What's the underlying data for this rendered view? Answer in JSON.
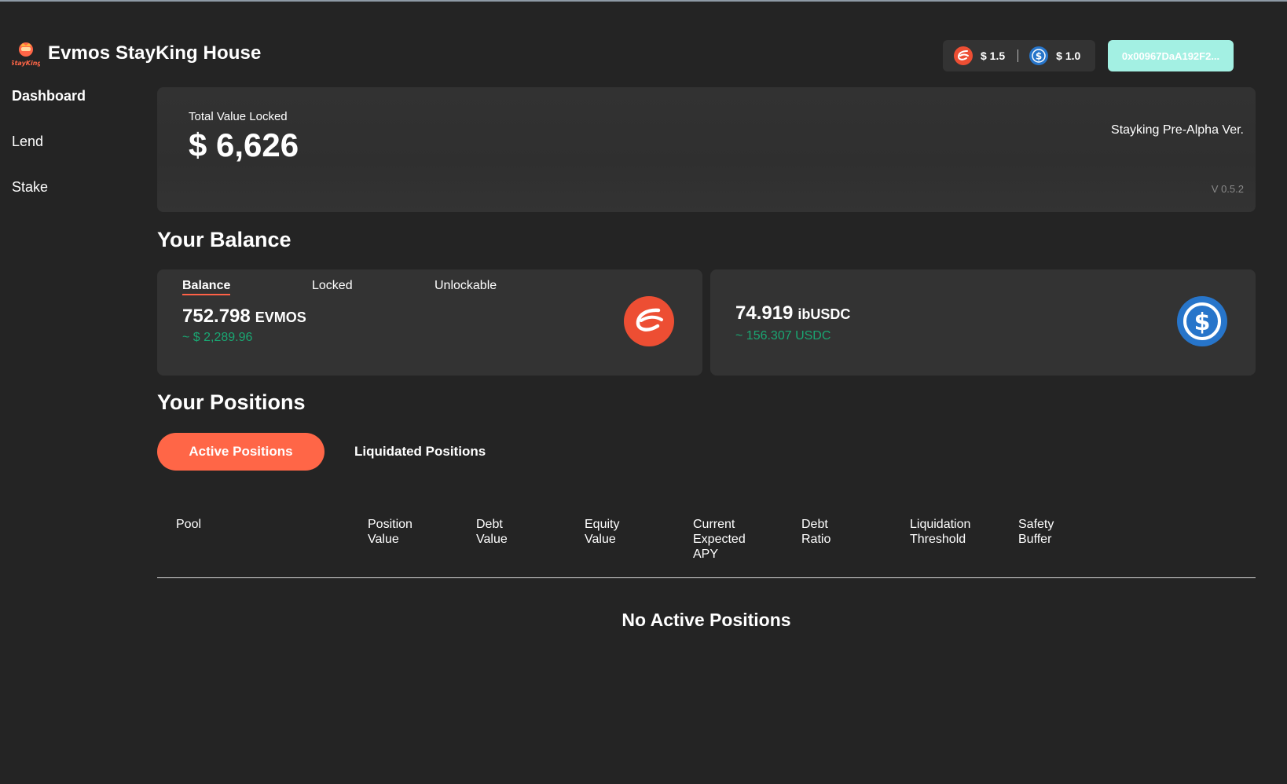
{
  "app": {
    "title": "Evmos StayKing House",
    "logo_text": "StayKing"
  },
  "header": {
    "prices": [
      {
        "icon": "evmos-coin-icon",
        "value": "$ 1.5"
      },
      {
        "icon": "usdc-coin-icon",
        "value": "$ 1.0"
      }
    ],
    "wallet_address": "0x00967DaA192F2..."
  },
  "sidebar": {
    "items": [
      {
        "label": "Dashboard",
        "active": true
      },
      {
        "label": "Lend",
        "active": false
      },
      {
        "label": "Stake",
        "active": false
      }
    ]
  },
  "tvl": {
    "label": "Total Value Locked",
    "value": "$ 6,626",
    "version_title": "Stayking Pre-Alpha Ver.",
    "version": "V 0.5.2"
  },
  "balance": {
    "title": "Your Balance",
    "tabs": [
      "Balance",
      "Locked",
      "Unlockable"
    ],
    "active_tab": "Balance",
    "cards": [
      {
        "amount": "752.798",
        "unit": "EVMOS",
        "usd": "~ $ 2,289.96",
        "icon": "evmos-coin-icon"
      },
      {
        "amount": "74.919",
        "unit": "ibUSDC",
        "usd": "~ 156.307 USDC",
        "icon": "usdc-coin-icon"
      }
    ]
  },
  "positions": {
    "title": "Your Positions",
    "tabs": [
      "Active Positions",
      "Liquidated Positions"
    ],
    "active_tab": "Active Positions",
    "columns": [
      "Pool",
      "Position\nValue",
      "Debt\nValue",
      "Equity\nValue",
      "Current\nExpected\nAPY",
      "Debt\nRatio",
      "Liquidation\nThreshold",
      "Safety\nBuffer"
    ],
    "empty_message": "No Active Positions"
  },
  "colors": {
    "background": "#242424",
    "card": "#333333",
    "accent": "#ff6647",
    "wallet_button": "#a3f0e3",
    "positive": "#1aa672",
    "evmos": "#ed4e33",
    "usdc": "#2775ca"
  }
}
